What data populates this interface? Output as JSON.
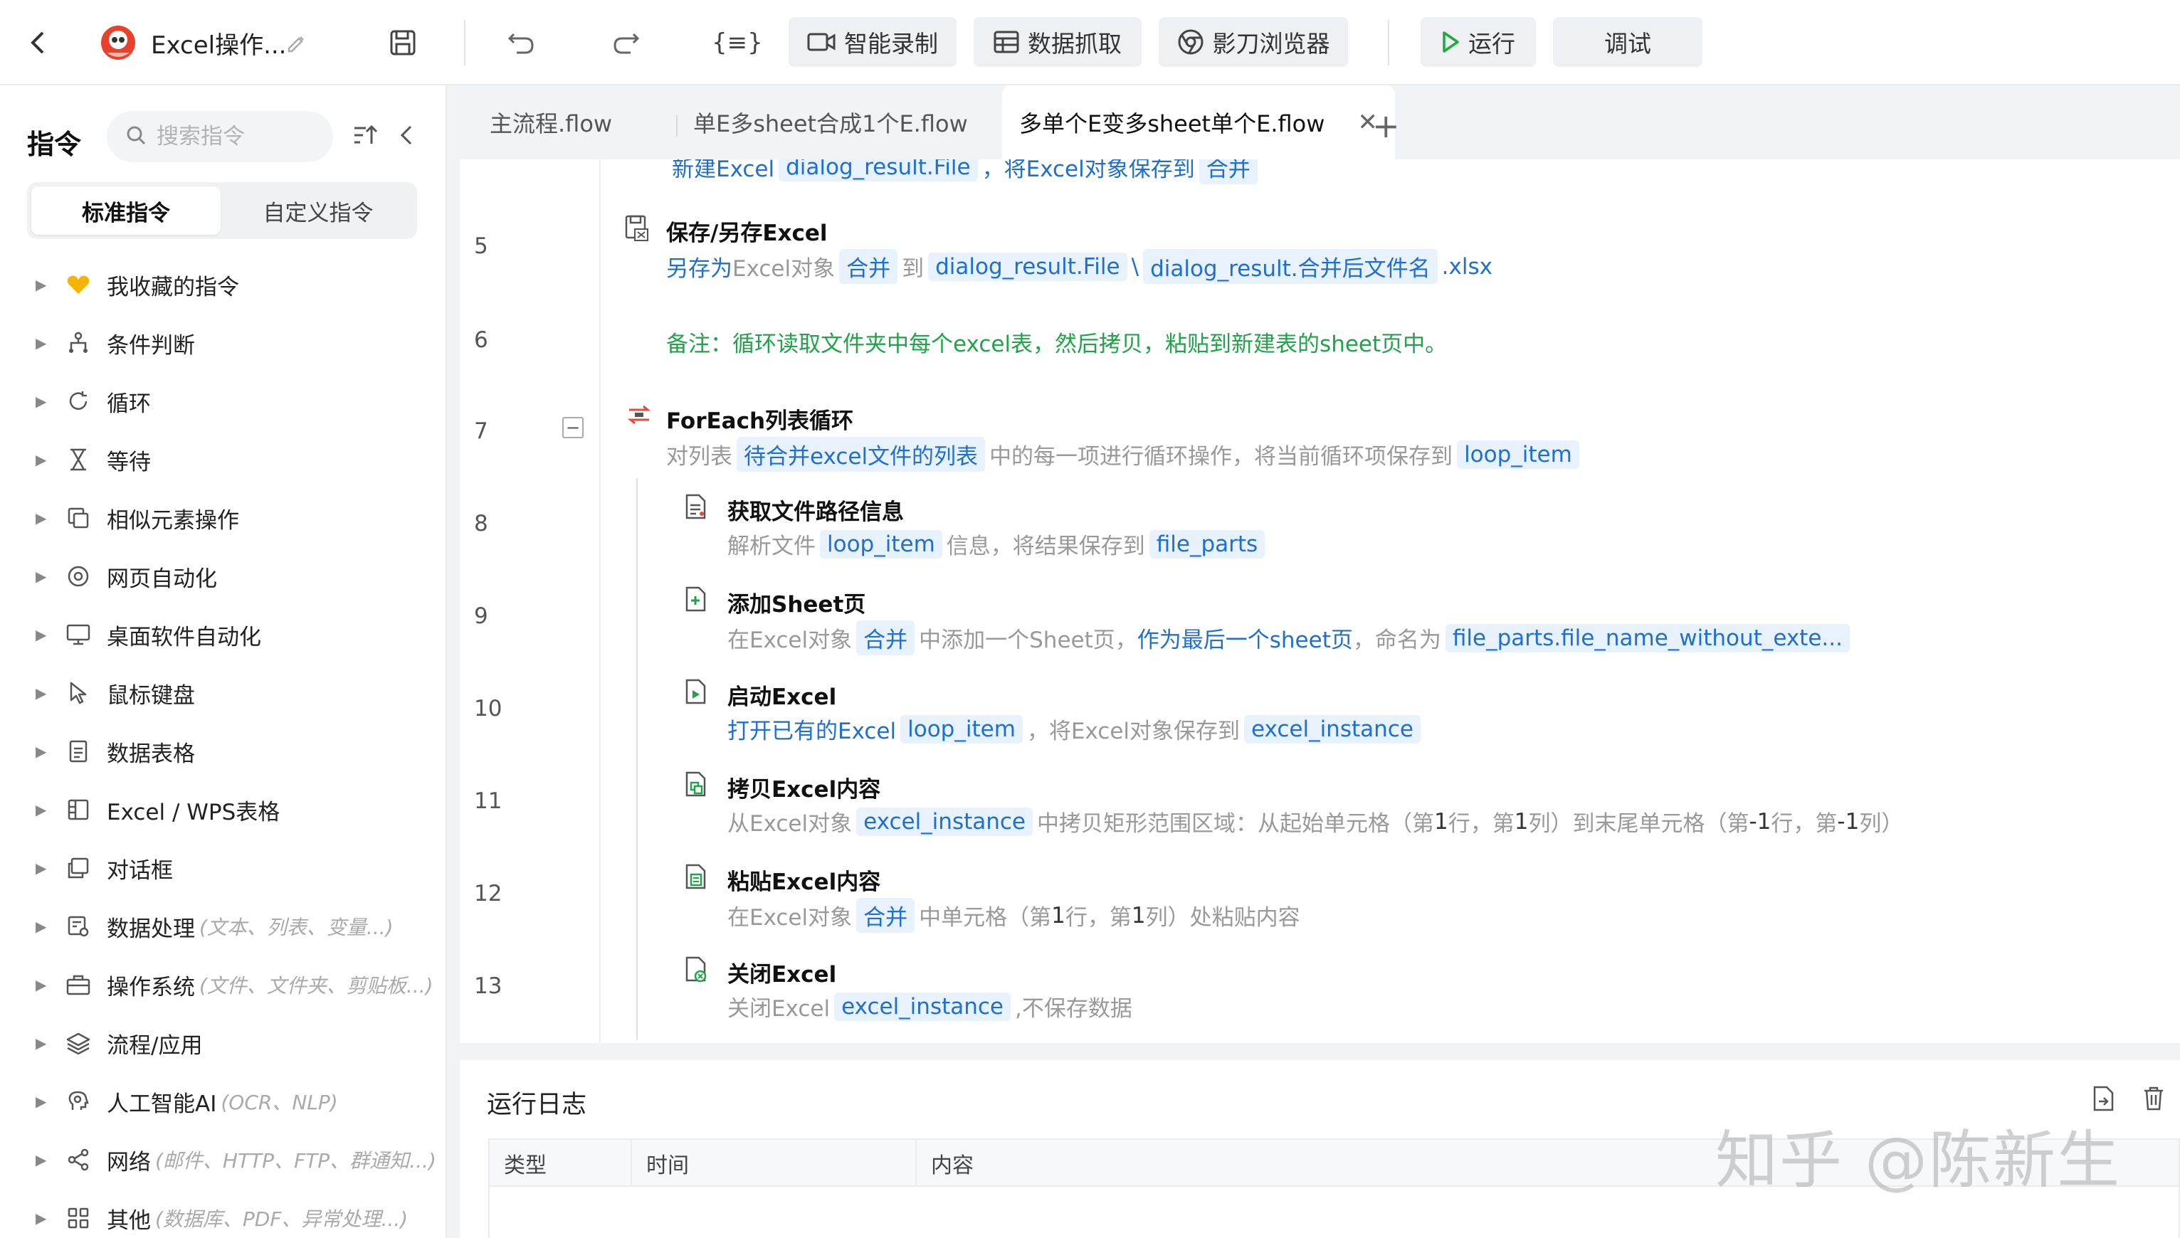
{
  "toolbar": {
    "title": "Excel操作...",
    "record_label": "智能录制",
    "capture_label": "数据抓取",
    "browser_label": "影刀浏览器",
    "run_label": "运行",
    "debug_label": "调试"
  },
  "sidebar": {
    "title": "指令",
    "search_placeholder": "搜索指令",
    "tabs": [
      "标准指令",
      "自定义指令"
    ],
    "items": [
      {
        "label": "我收藏的指令",
        "hint": ""
      },
      {
        "label": "条件判断",
        "hint": ""
      },
      {
        "label": "循环",
        "hint": ""
      },
      {
        "label": "等待",
        "hint": ""
      },
      {
        "label": "相似元素操作",
        "hint": ""
      },
      {
        "label": "网页自动化",
        "hint": ""
      },
      {
        "label": "桌面软件自动化",
        "hint": ""
      },
      {
        "label": "鼠标键盘",
        "hint": ""
      },
      {
        "label": "数据表格",
        "hint": ""
      },
      {
        "label": "Excel / WPS表格",
        "hint": ""
      },
      {
        "label": "对话框",
        "hint": ""
      },
      {
        "label": "数据处理",
        "hint": "(文本、列表、变量...)"
      },
      {
        "label": "操作系统",
        "hint": "(文件、文件夹、剪贴板...)"
      },
      {
        "label": "流程/应用",
        "hint": ""
      },
      {
        "label": "人工智能AI",
        "hint": "(OCR、NLP)"
      },
      {
        "label": "网络",
        "hint": "(邮件、HTTP、FTP、群通知...)"
      },
      {
        "label": "其他",
        "hint": "(数据库、PDF、异常处理...)"
      }
    ]
  },
  "file_tabs": [
    "主流程.flow",
    "单E多sheet合成1个E.flow",
    "多单个E变多sheet单个E.flow"
  ],
  "editor": {
    "partial_line": {
      "a": "新建Excel",
      "b": "dialog_result.File",
      "c": "，将Excel对象保存到",
      "d": "合并"
    },
    "steps": [
      {
        "num": "5",
        "title": "保存/另存Excel",
        "d": [
          "另存为",
          "Excel对象",
          "合并",
          "到",
          "dialog_result.File",
          "\\",
          "dialog_result.合并后文件名",
          ".xlsx"
        ]
      },
      {
        "num": "6",
        "comment": "备注：循环读取文件夹中每个excel表，然后拷贝，粘贴到新建表的sheet页中。"
      },
      {
        "num": "7",
        "title": "ForEach列表循环",
        "d": [
          "对列表",
          "待合并excel文件的列表",
          "中的每一项进行循环操作，将当前循环项保存到",
          "loop_item"
        ]
      },
      {
        "num": "8",
        "title": "获取文件路径信息",
        "d": [
          "解析文件",
          "loop_item",
          "信息，将结果保存到",
          "file_parts"
        ]
      },
      {
        "num": "9",
        "title": "添加Sheet页",
        "d": [
          "在Excel对象",
          "合并",
          "中添加一个Sheet页，",
          "作为最后一个sheet页",
          "，命名为",
          "file_parts.file_name_without_exte..."
        ]
      },
      {
        "num": "10",
        "title": "启动Excel",
        "d": [
          "打开已有的Excel",
          "loop_item",
          "，将Excel对象保存到",
          "excel_instance"
        ]
      },
      {
        "num": "11",
        "title": "拷贝Excel内容",
        "d": [
          "从Excel对象",
          "excel_instance",
          "中拷贝矩形范围区域：从起始单元格（第",
          "1",
          "行，第",
          "1",
          "列）到末尾单元格（第",
          "-1",
          "行，第",
          "-1",
          "列）"
        ]
      },
      {
        "num": "12",
        "title": "粘贴Excel内容",
        "d": [
          "在Excel对象",
          "合并",
          "中单元格（第",
          "1",
          "行，第",
          "1",
          "列）处粘贴内容"
        ]
      },
      {
        "num": "13",
        "title": "关闭Excel",
        "d": [
          "关闭Excel",
          "excel_instance",
          ",不保存数据"
        ]
      }
    ]
  },
  "log": {
    "title": "运行日志",
    "columns": [
      "类型",
      "时间",
      "内容"
    ]
  },
  "watermark": "知乎 @陈新生",
  "colors": {
    "accent_blue": "#1f6fd1",
    "chip_bg": "#e8f2fd",
    "comment_green": "#21a34a",
    "run_green": "#1aad3c"
  }
}
